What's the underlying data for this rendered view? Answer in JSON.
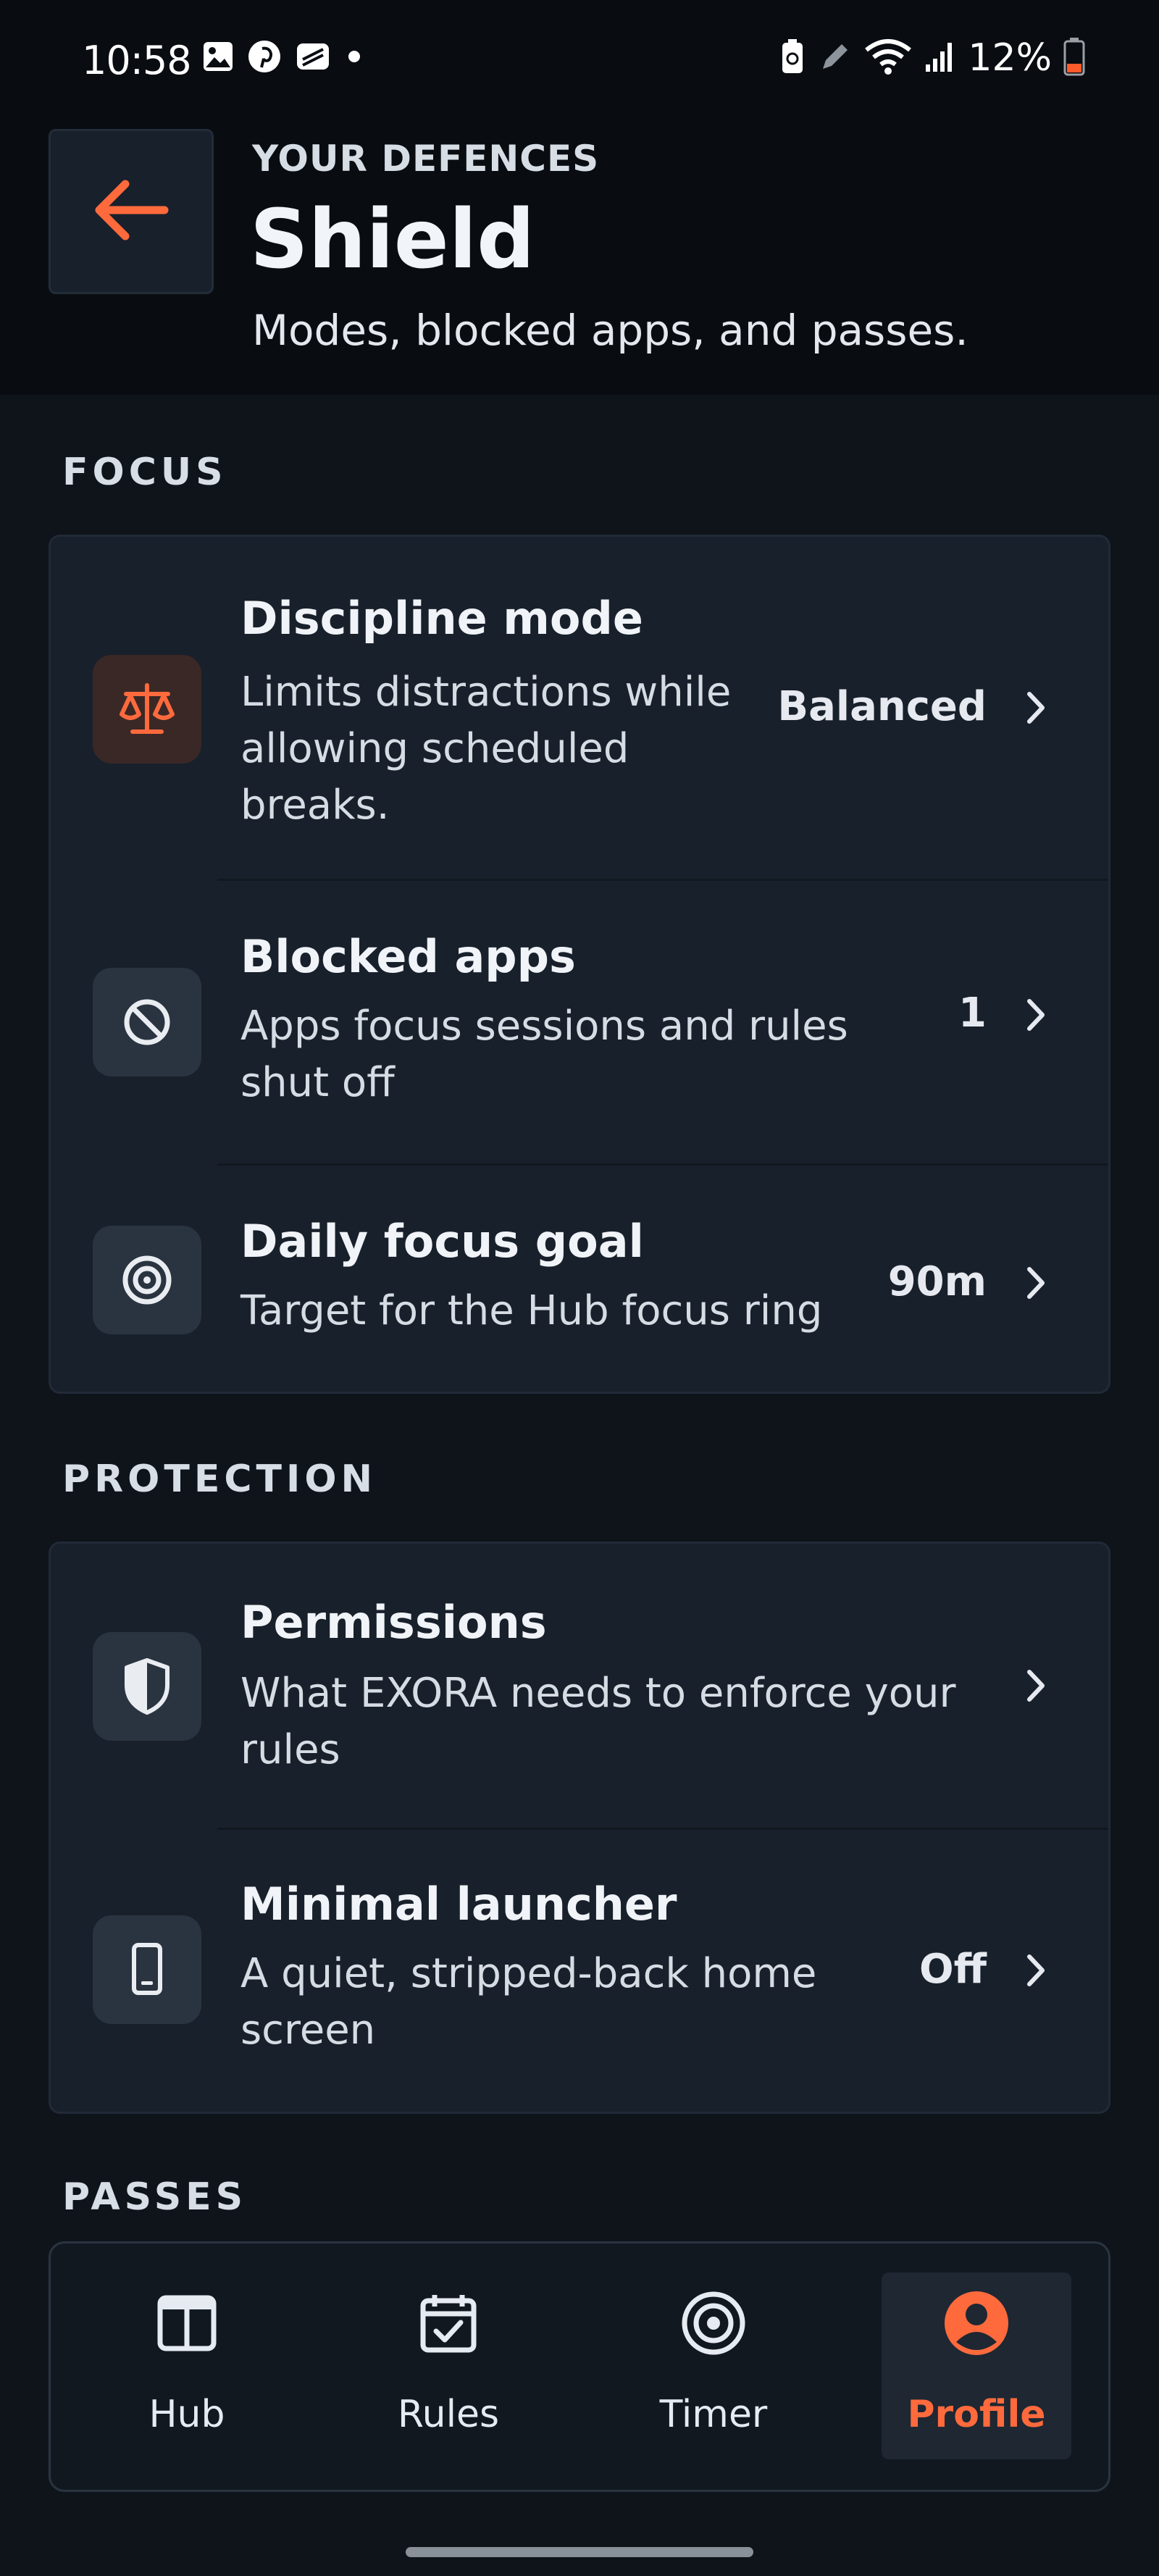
{
  "status_bar": {
    "time": "10:58",
    "battery_percent": "12%",
    "icons_left": [
      "gallery-icon",
      "pinterest-icon",
      "stack-app-icon",
      "dot-icon"
    ],
    "icons_right": [
      "battery-saver-icon",
      "pen-icon",
      "wifi-icon",
      "signal-icon",
      "battery-icon"
    ]
  },
  "header": {
    "overline": "YOUR DEFENCES",
    "title": "Shield",
    "subtitle": "Modes, blocked apps, and passes."
  },
  "sections": {
    "focus": {
      "label": "FOCUS",
      "rows": [
        {
          "title": "Discipline mode",
          "desc_lines": [
            "Limits distractions while",
            "allowing scheduled",
            "breaks."
          ],
          "value": "Balanced",
          "icon": "balance-scale-icon"
        },
        {
          "title": "Blocked apps",
          "desc_lines": [
            "Apps focus sessions and rules",
            "shut off"
          ],
          "value": "1",
          "icon": "block-icon"
        },
        {
          "title": "Daily focus goal",
          "desc_lines": [
            "Target for the Hub focus ring"
          ],
          "value": "90m",
          "icon": "target-icon"
        }
      ]
    },
    "protection": {
      "label": "PROTECTION",
      "rows": [
        {
          "title": "Permissions",
          "desc_lines": [
            "What EXORA needs to enforce your",
            "rules"
          ],
          "value": "",
          "icon": "shield-icon"
        },
        {
          "title": "Minimal launcher",
          "desc_lines": [
            "A quiet, stripped-back home",
            "screen"
          ],
          "value": "Off",
          "icon": "phone-icon"
        }
      ]
    },
    "passes": {
      "label": "PASSES"
    }
  },
  "bottom_nav": {
    "items": [
      {
        "label": "Hub",
        "icon": "hub-icon",
        "active": false
      },
      {
        "label": "Rules",
        "icon": "calendar-check-icon",
        "active": false
      },
      {
        "label": "Timer",
        "icon": "target-icon",
        "active": false
      },
      {
        "label": "Profile",
        "icon": "profile-icon",
        "active": true
      }
    ]
  },
  "colors": {
    "accent": "#ff6a3d",
    "background": "#0f141b",
    "card": "#18202b",
    "header": "#090d12"
  }
}
